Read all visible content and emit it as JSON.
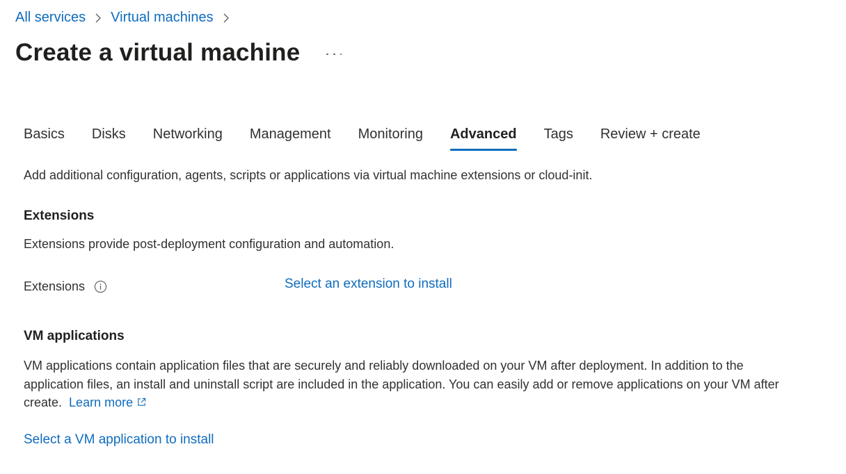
{
  "breadcrumb": {
    "items": [
      "All services",
      "Virtual machines"
    ]
  },
  "page": {
    "title": "Create a virtual machine"
  },
  "tabs": [
    {
      "label": "Basics"
    },
    {
      "label": "Disks"
    },
    {
      "label": "Networking"
    },
    {
      "label": "Management"
    },
    {
      "label": "Monitoring"
    },
    {
      "label": "Advanced"
    },
    {
      "label": "Tags"
    },
    {
      "label": "Review + create"
    }
  ],
  "active_tab": "Advanced",
  "intro": "Add additional configuration, agents, scripts or applications via virtual machine extensions or cloud-init.",
  "extensions": {
    "heading": "Extensions",
    "description": "Extensions provide post-deployment configuration and automation.",
    "field_label": "Extensions",
    "select_link": "Select an extension to install"
  },
  "vm_applications": {
    "heading": "VM applications",
    "description": "VM applications contain application files that are securely and reliably downloaded on your VM after deployment. In addition to the application files, an install and uninstall script are included in the application. You can easily add or remove applications on your VM after create.",
    "learn_more": "Learn more",
    "select_link": "Select a VM application to install"
  },
  "colors": {
    "accent": "#0f6cbd",
    "text": "#323130",
    "heading": "#201f1e"
  }
}
